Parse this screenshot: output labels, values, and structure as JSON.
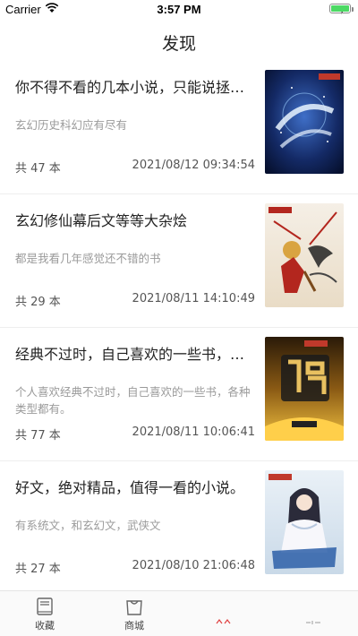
{
  "status": {
    "carrier": "Carrier",
    "time": "3:57 PM"
  },
  "nav": {
    "title": "发现"
  },
  "items": [
    {
      "title": "你不得不看的几本小说，只能说拯救…",
      "desc": "玄幻历史科幻应有尽有",
      "count": "共 47 本",
      "date": "2021/08/12 09:34:54",
      "cover_icon": "book-cover-dark-blue"
    },
    {
      "title": "玄幻修仙幕后文等等大杂烩",
      "desc": "都是我看几年感觉还不错的书",
      "count": "共 29 本",
      "date": "2021/08/11 14:10:49",
      "cover_icon": "book-cover-warrior"
    },
    {
      "title": "经典不过时，自己喜欢的一些书，各…",
      "desc": "个人喜欢经典不过时，自己喜欢的一些书，各种类型都有。",
      "count": "共 77 本",
      "date": "2021/08/11 10:06:41",
      "cover_icon": "book-cover-golden"
    },
    {
      "title": "好文，绝对精品，值得一看的小说。",
      "desc": "有系统文，和玄幻文，武侠文",
      "count": "共 27 本",
      "date": "2021/08/10 21:06:48",
      "cover_icon": "book-cover-lady"
    }
  ],
  "tabs": [
    {
      "label": "收藏",
      "icon": "book-icon"
    },
    {
      "label": "商城",
      "icon": "bag-icon"
    }
  ]
}
